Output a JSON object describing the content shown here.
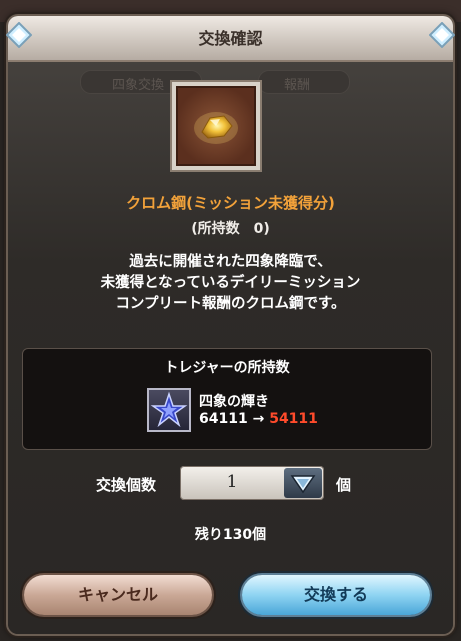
{
  "dialog": {
    "title": "交換確認"
  },
  "item": {
    "name": "クロム鋼(ミッション未獲得分)",
    "owned": "(所持数　0)",
    "description_lines": [
      "過去に開催された四象降臨で、",
      "未獲得となっているデイリーミッション",
      "コンプリート報酬のクロム鋼です。"
    ]
  },
  "treasure": {
    "section_title": "トレジャーの所持数",
    "name": "四象の輝き",
    "before": "64111",
    "arrow": "→",
    "after": "54111"
  },
  "quantity": {
    "label": "交換個数",
    "value": "1",
    "unit": "個"
  },
  "remaining": "残り130個",
  "buttons": {
    "cancel": "キャンセル",
    "exchange": "交換する"
  },
  "background": {
    "tab_left": "四象交換",
    "tab_right": "報酬"
  }
}
